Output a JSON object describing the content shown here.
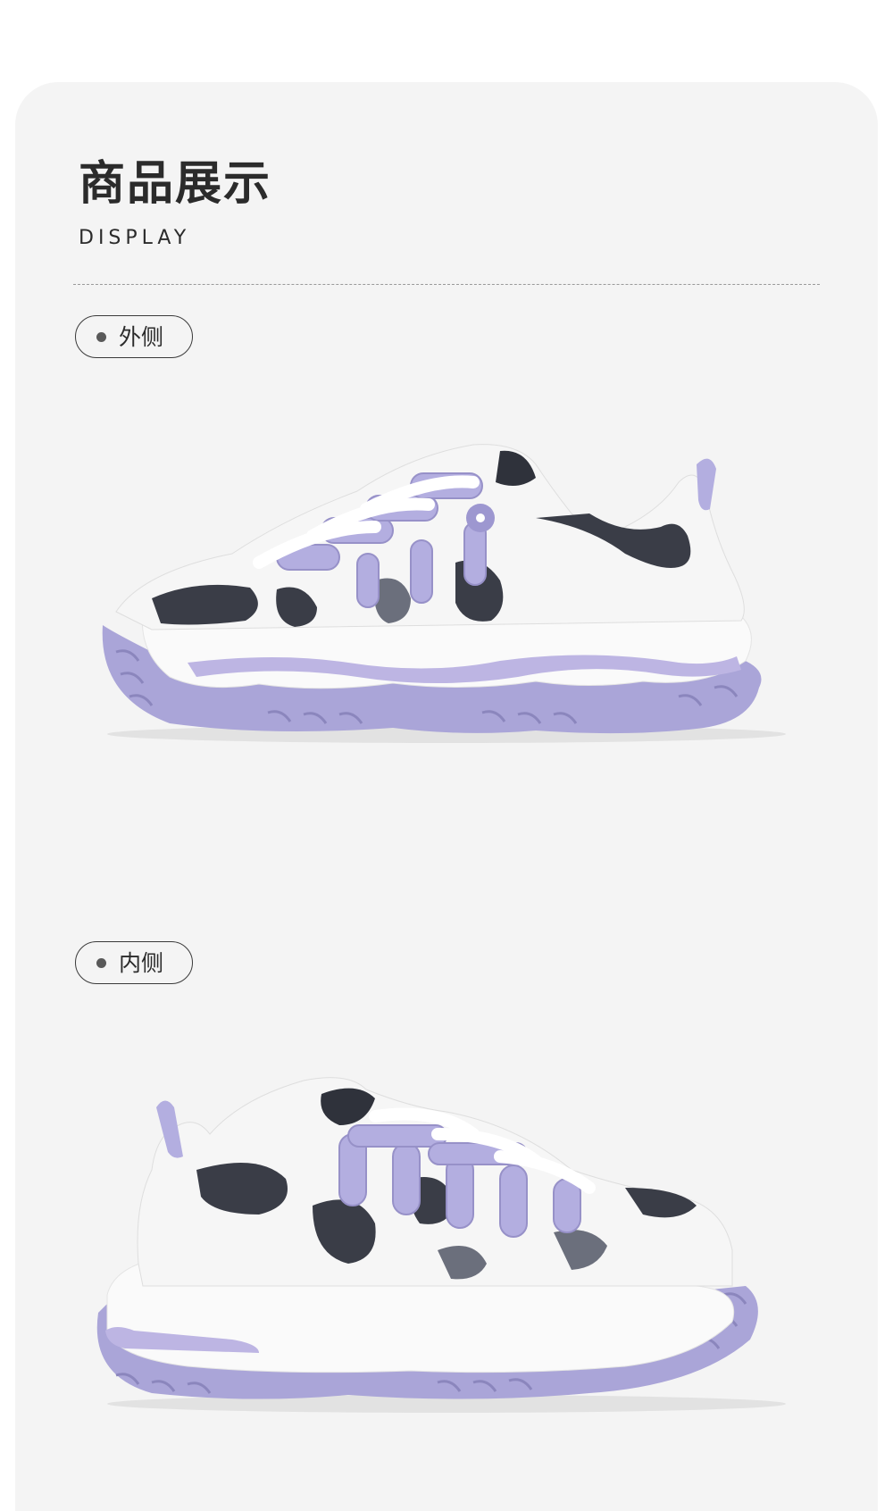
{
  "header": {
    "title": "商品展示",
    "subtitle": "DISPLAY"
  },
  "sections": [
    {
      "label": "外侧",
      "image": "sneaker-outer-side-view"
    },
    {
      "label": "内侧",
      "image": "sneaker-inner-side-view"
    }
  ],
  "colors": {
    "background": "#f4f4f4",
    "accent_lavender": "#a9a3d6",
    "dark_mesh": "#3a3d47",
    "text": "#2b2b2b"
  }
}
